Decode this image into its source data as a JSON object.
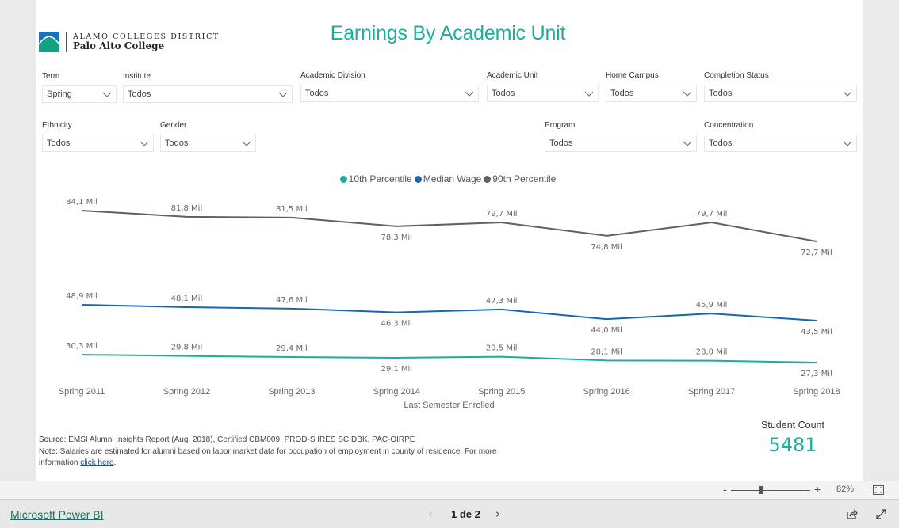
{
  "header": {
    "logo_line1": "ALAMO COLLEGES DISTRICT",
    "logo_line2": "Palo Alto College",
    "title": "Earnings By Academic Unit"
  },
  "slicers": [
    {
      "label": "Term",
      "value": "Spring"
    },
    {
      "label": "Institute",
      "value": "Todos"
    },
    {
      "label": "Academic Division",
      "value": "Todos"
    },
    {
      "label": "Academic Unit",
      "value": "Todos"
    },
    {
      "label": "Home Campus",
      "value": "Todos"
    },
    {
      "label": "Completion Status",
      "value": "Todos"
    },
    {
      "label": "Ethnicity",
      "value": "Todos"
    },
    {
      "label": "Gender",
      "value": "Todos"
    },
    {
      "label": "Program",
      "value": "Todos"
    },
    {
      "label": "Concentration",
      "value": "Todos"
    }
  ],
  "chart_data": {
    "type": "line",
    "title": "",
    "xlabel": "Last Semester Enrolled",
    "ylabel": "",
    "categories": [
      "Spring 2011",
      "Spring 2012",
      "Spring 2013",
      "Spring 2014",
      "Spring 2015",
      "Spring 2016",
      "Spring 2017",
      "Spring 2018"
    ],
    "legend_position": "top-center",
    "grid": false,
    "series": [
      {
        "name": "10th Percentile",
        "color": "#1aaf9c",
        "values": [
          30.3,
          29.8,
          29.4,
          29.1,
          29.5,
          28.1,
          28.0,
          27.3
        ],
        "labels": [
          "30,3 Mil",
          "29,8 Mil",
          "29,4 Mil",
          "29,1 Mil",
          "29,5 Mil",
          "28,1 Mil",
          "28,0 Mil",
          "27,3 Mil"
        ]
      },
      {
        "name": "Median Wage",
        "color": "#1766b0",
        "values": [
          48.9,
          48.1,
          47.6,
          46.3,
          47.3,
          44.0,
          45.9,
          43.5
        ],
        "labels": [
          "48,9 Mil",
          "48,1 Mil",
          "47,6 Mil",
          "46,3 Mil",
          "47,3 Mil",
          "44,0 Mil",
          "45,9 Mil",
          "43,5 Mil"
        ]
      },
      {
        "name": "90th Percentile",
        "color": "#5a6262",
        "values": [
          84.1,
          81.8,
          81.5,
          78.3,
          79.7,
          74.8,
          79.7,
          72.7
        ],
        "labels": [
          "84,1 Mil",
          "81,8 Mil",
          "81,5 Mil",
          "78,3 Mil",
          "79,7 Mil",
          "74,8 Mil",
          "79,7 Mil",
          "72,7 Mil"
        ]
      }
    ],
    "units": "thousands (Mil)"
  },
  "notes": {
    "source_key": "Source:",
    "source_text": " EMSI Alumni Insights Report (Aug. 2018), Certified CBM009, PROD-S IRES SC DBK, PAC-OIRPE",
    "note_key": "Note:",
    "note_text": " Salaries are estimated for alumni based on labor market data for occupation of employment in county of residence. For more information ",
    "link_text": "click here",
    "after_link": "."
  },
  "card": {
    "label": "Student Count",
    "value": "5481"
  },
  "zoom": {
    "minus": "-",
    "plus": "+",
    "percent": "82%",
    "level": 0.82
  },
  "footer": {
    "brand": "Microsoft Power BI",
    "prev": "‹",
    "page": "1 de 2",
    "next": "›"
  }
}
